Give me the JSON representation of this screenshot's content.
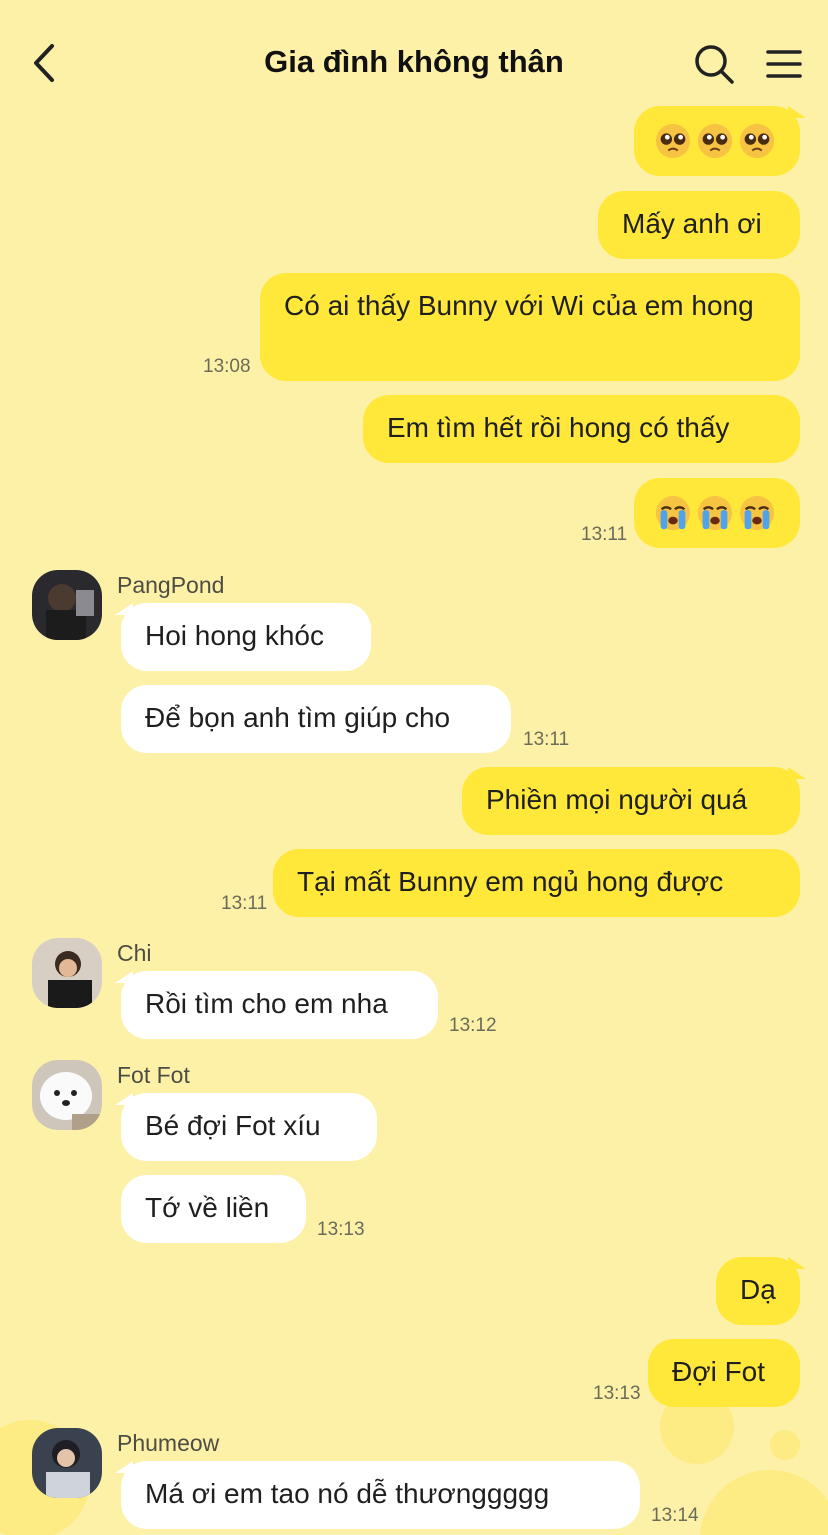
{
  "header": {
    "title": "Gia đình không thân"
  },
  "messages": {
    "m1": {
      "emojis": "pleading-face x3"
    },
    "m2": {
      "text": "Mấy anh ơi"
    },
    "m3": {
      "text": "Có ai thấy Bunny với Wi của em hong",
      "time": "13:08"
    },
    "m4": {
      "text": "Em tìm hết rồi hong có thấy"
    },
    "m5": {
      "emojis": "loudly-crying-face x3",
      "time": "13:11"
    },
    "g1": {
      "sender": "PangPond",
      "text1": "Hoi hong khóc",
      "text2": "Để bọn anh tìm giúp cho",
      "time": "13:11"
    },
    "m6": {
      "text": "Phiền mọi người quá"
    },
    "m7": {
      "text": "Tại mất Bunny em ngủ hong được",
      "time": "13:11"
    },
    "g2": {
      "sender": "Chi",
      "text1": "Rồi tìm cho em nha",
      "time": "13:12"
    },
    "g3": {
      "sender": "Fot Fot",
      "text1": "Bé đợi Fot xíu",
      "text2": "Tớ về liền",
      "time": "13:13"
    },
    "m8": {
      "text": "Dạ"
    },
    "m9": {
      "text": "Đợi Fot",
      "time": "13:13"
    },
    "g4": {
      "sender": "Phumeow",
      "text1": "Má ơi em tao nó dễ thươnggggg",
      "time": "13:14"
    }
  },
  "colors": {
    "background": "#fdf1a8",
    "my_bubble": "#ffe83a",
    "other_bubble": "#ffffff"
  }
}
